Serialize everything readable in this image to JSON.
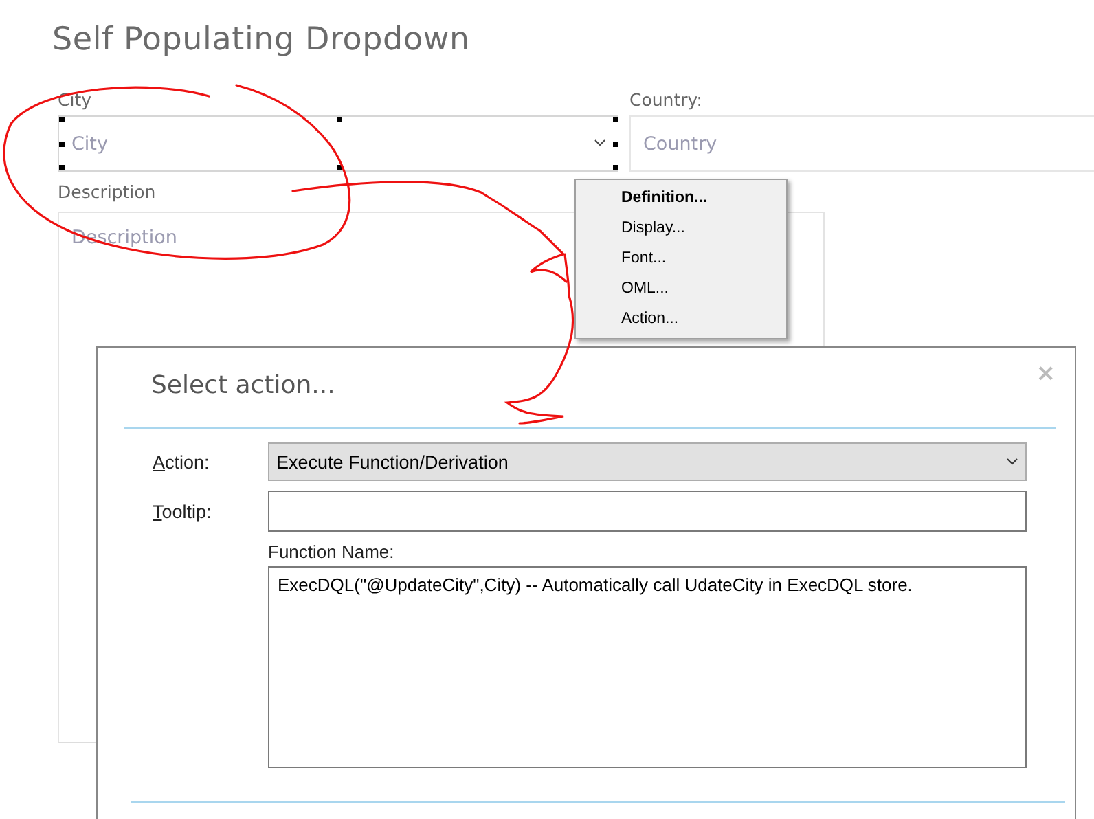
{
  "page": {
    "title": "Self Populating Dropdown"
  },
  "form": {
    "fields": [
      {
        "kind": "dropdown",
        "label": "City",
        "placeholder": "City",
        "selected": true
      },
      {
        "kind": "text",
        "label": "Country:",
        "placeholder": "Country",
        "selected": false
      }
    ],
    "description": {
      "label": "Description",
      "placeholder": "Description"
    }
  },
  "context_menu": {
    "items": [
      {
        "label": "Definition...",
        "default": true
      },
      {
        "label": "Display...",
        "default": false
      },
      {
        "label": "Font...",
        "default": false
      },
      {
        "label": "OML...",
        "default": false
      },
      {
        "label": "Action...",
        "default": false
      }
    ]
  },
  "dialog": {
    "title": "Select action...",
    "close": "×",
    "action": {
      "label": "Action:",
      "value": "Execute Function/Derivation"
    },
    "tooltip": {
      "label": "Tooltip:"
    },
    "function": {
      "label": "Function Name:",
      "value": "ExecDQL(\"@UpdateCity\",City) -- Automatically call UdateCity in ExecDQL store."
    }
  }
}
